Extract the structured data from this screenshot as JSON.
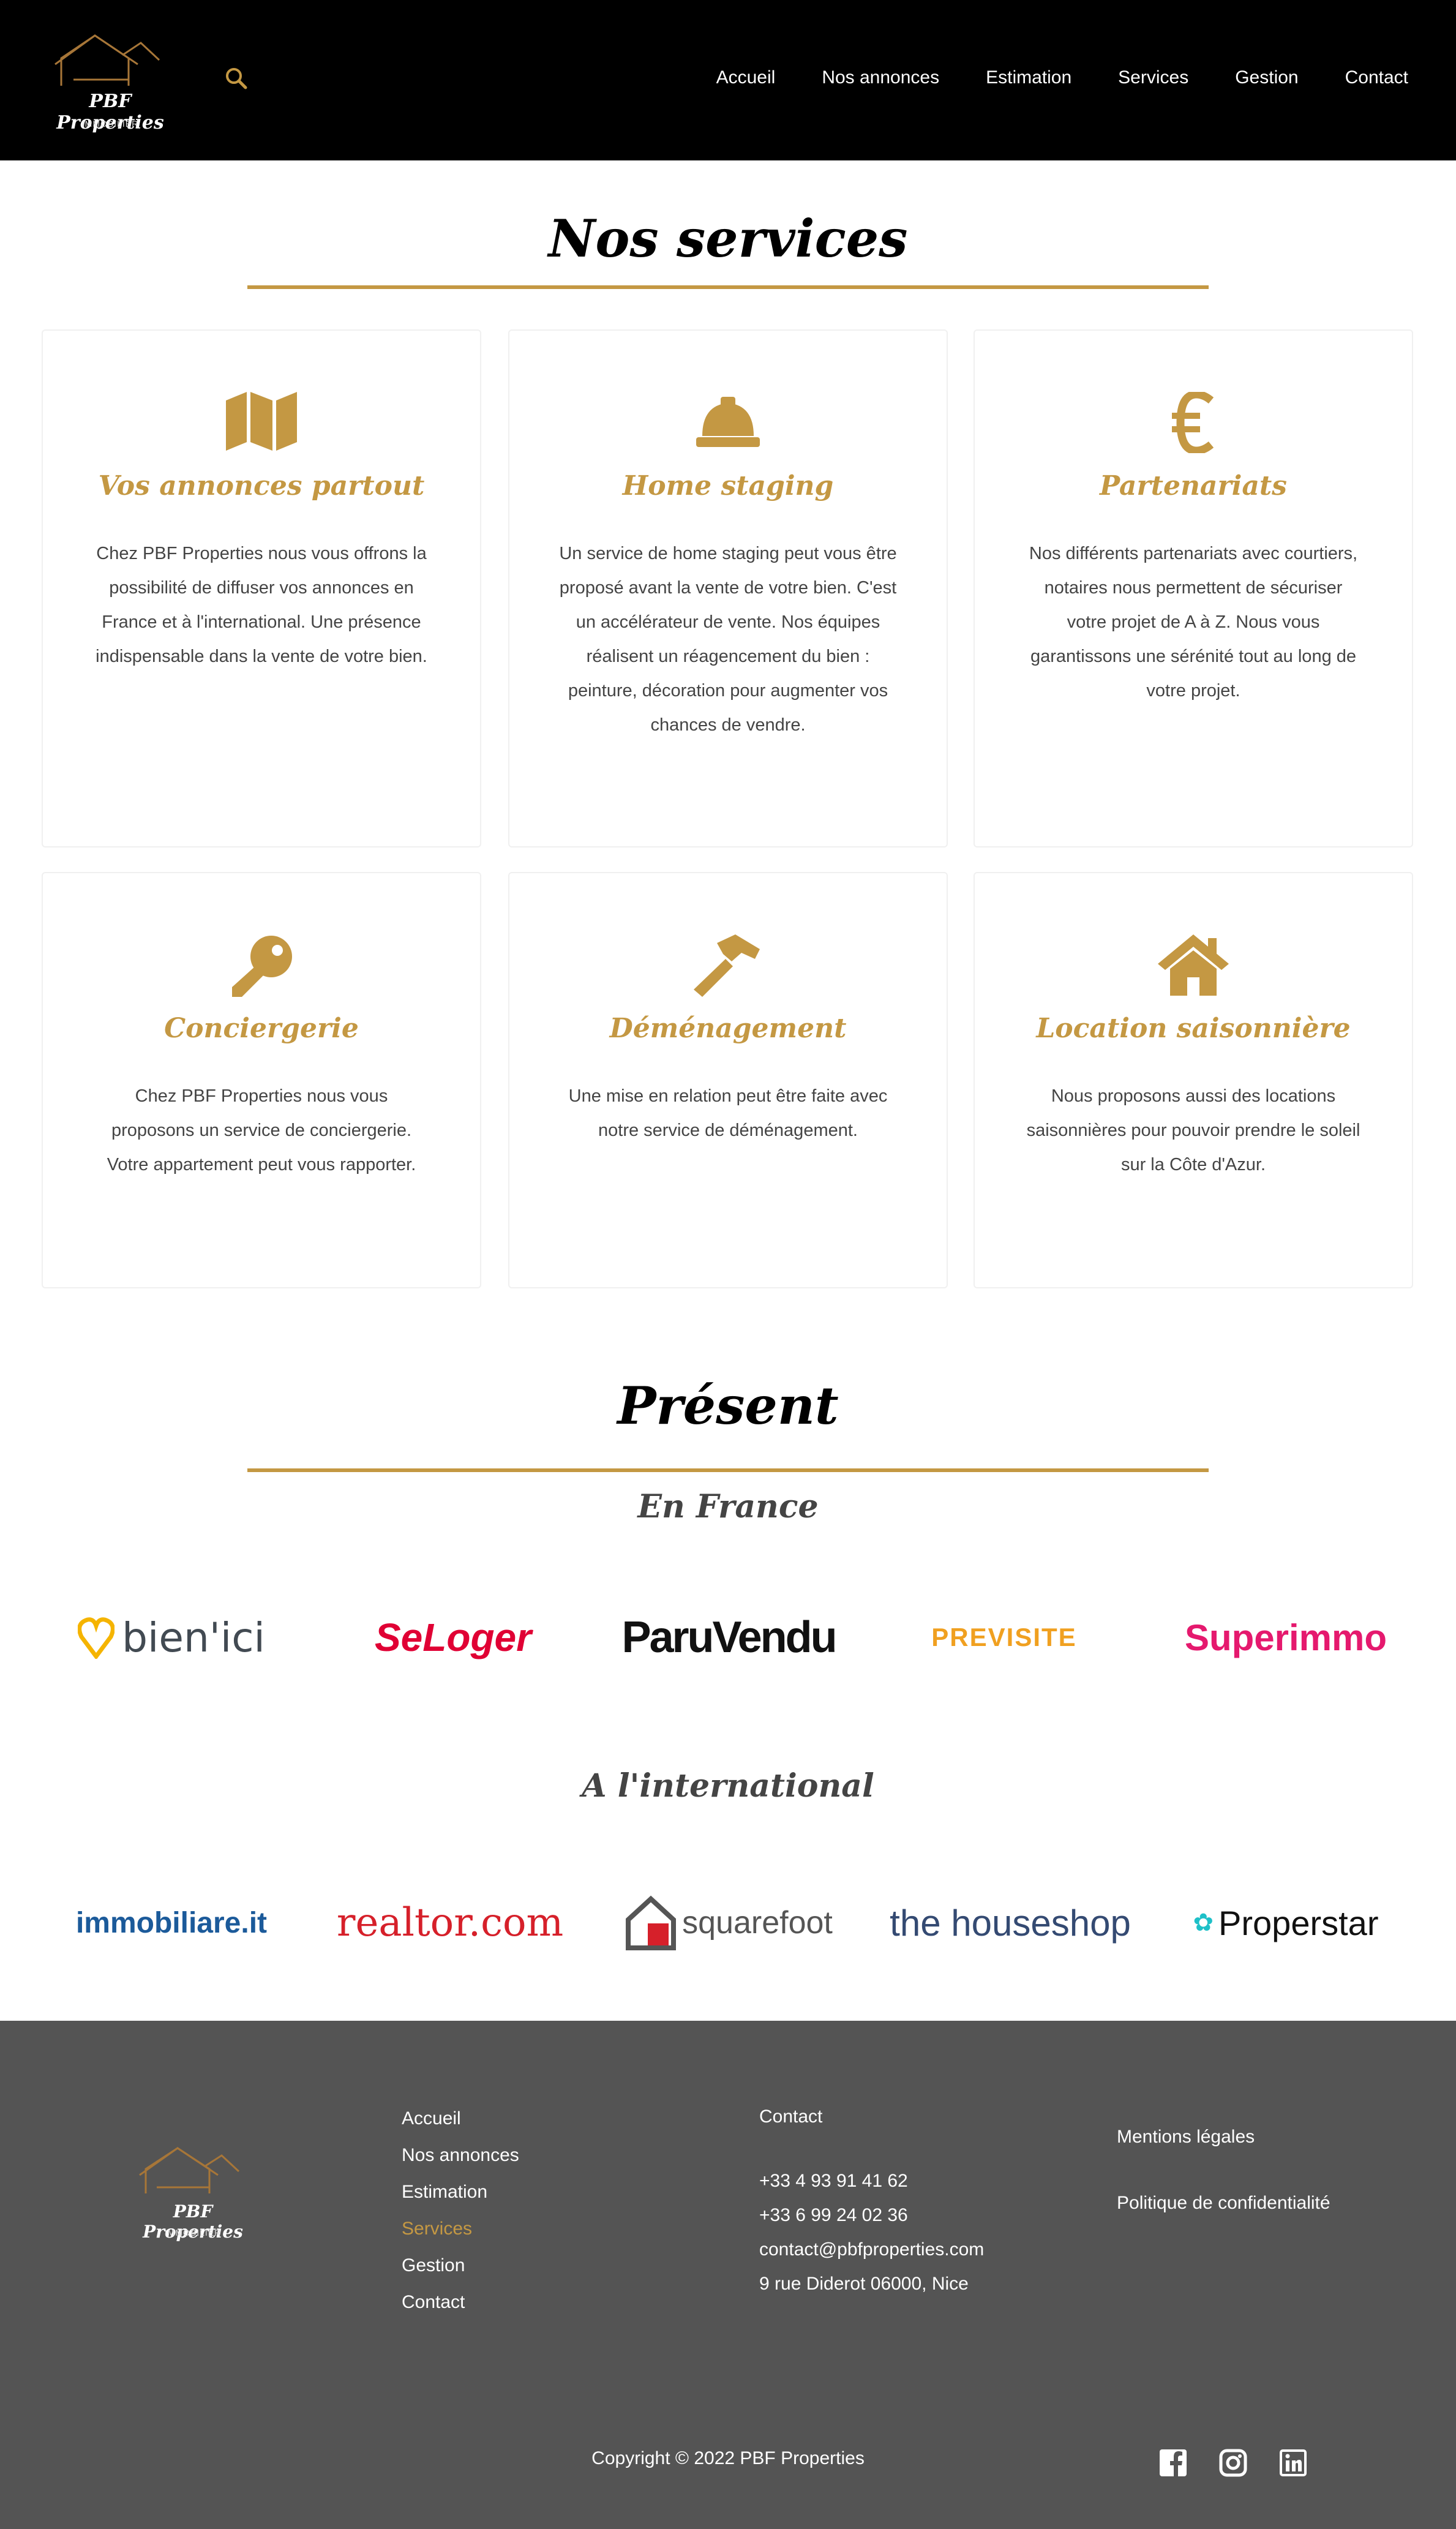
{
  "header": {
    "brand": "PBF Properties",
    "brand_sub": "IMMOBILIER",
    "nav": [
      "Accueil",
      "Nos annonces",
      "Estimation",
      "Services",
      "Gestion",
      "Contact"
    ]
  },
  "services": {
    "heading": "Nos services",
    "cards": [
      {
        "title": "Vos annonces partout",
        "icon": "map-icon",
        "text": "Chez PBF Properties nous vous offrons la possibilité de diffuser vos annonces en France et à l'international. Une présence indispensable dans la vente de votre bien."
      },
      {
        "title": "Home staging",
        "icon": "hard-hat-icon",
        "text": "Un service de home staging peut vous être proposé avant la vente de votre bien. C'est un accélérateur de vente. Nos équipes réalisent un réagencement du bien : peinture, décoration pour augmenter vos chances de vendre."
      },
      {
        "title": "Partenariats",
        "icon": "euro-icon",
        "text": "Nos différents partenariats avec courtiers, notaires nous permettent de sécuriser votre projet de A à Z. Nous vous garantissons une sérénité tout au long de votre projet."
      },
      {
        "title": "Conciergerie",
        "icon": "key-icon",
        "text": "Chez PBF Properties nous vous proposons un service de conciergerie. Votre appartement peut vous rapporter."
      },
      {
        "title": "Déménagement",
        "icon": "hammer-icon",
        "text": "Une mise en relation peut être faite avec notre service de déménagement."
      },
      {
        "title": "Location saisonnière",
        "icon": "house-icon",
        "text": "Nous proposons aussi des locations saisonnières pour pouvoir prendre le soleil sur la Côte d'Azur."
      }
    ]
  },
  "present": {
    "heading": "Présent",
    "france_heading": "En France",
    "france_logos": [
      "bien'ici",
      "SeLoger",
      "ParuVendu",
      "PREVISITE",
      "Superimmo"
    ],
    "international_heading": "A l'international",
    "international_logos": [
      "immobiliare.it",
      "realtor.com",
      "squarefoot",
      "the houseshop",
      "Properstar"
    ]
  },
  "footer": {
    "brand": "PBF Properties",
    "brand_sub": "IMMOBILIER",
    "links": [
      "Accueil",
      "Nos annonces",
      "Estimation",
      "Services",
      "Gestion",
      "Contact"
    ],
    "active_link": "Services",
    "contact_title": "Contact",
    "phone1": "+33 4 93 91 41 62",
    "phone2": "+33 6 99 24 02 36",
    "email": "contact@pbfproperties.com",
    "address": "9 rue Diderot 06000, Nice",
    "legal": "Mentions légales",
    "privacy": "Politique de confidentialité",
    "copyright": "Copyright © 2022 PBF Properties",
    "social": [
      "facebook-icon",
      "instagram-icon",
      "linkedin-icon"
    ]
  },
  "colors": {
    "accent": "#c49843",
    "header_bg": "#000000",
    "footer_bg": "#545454"
  }
}
